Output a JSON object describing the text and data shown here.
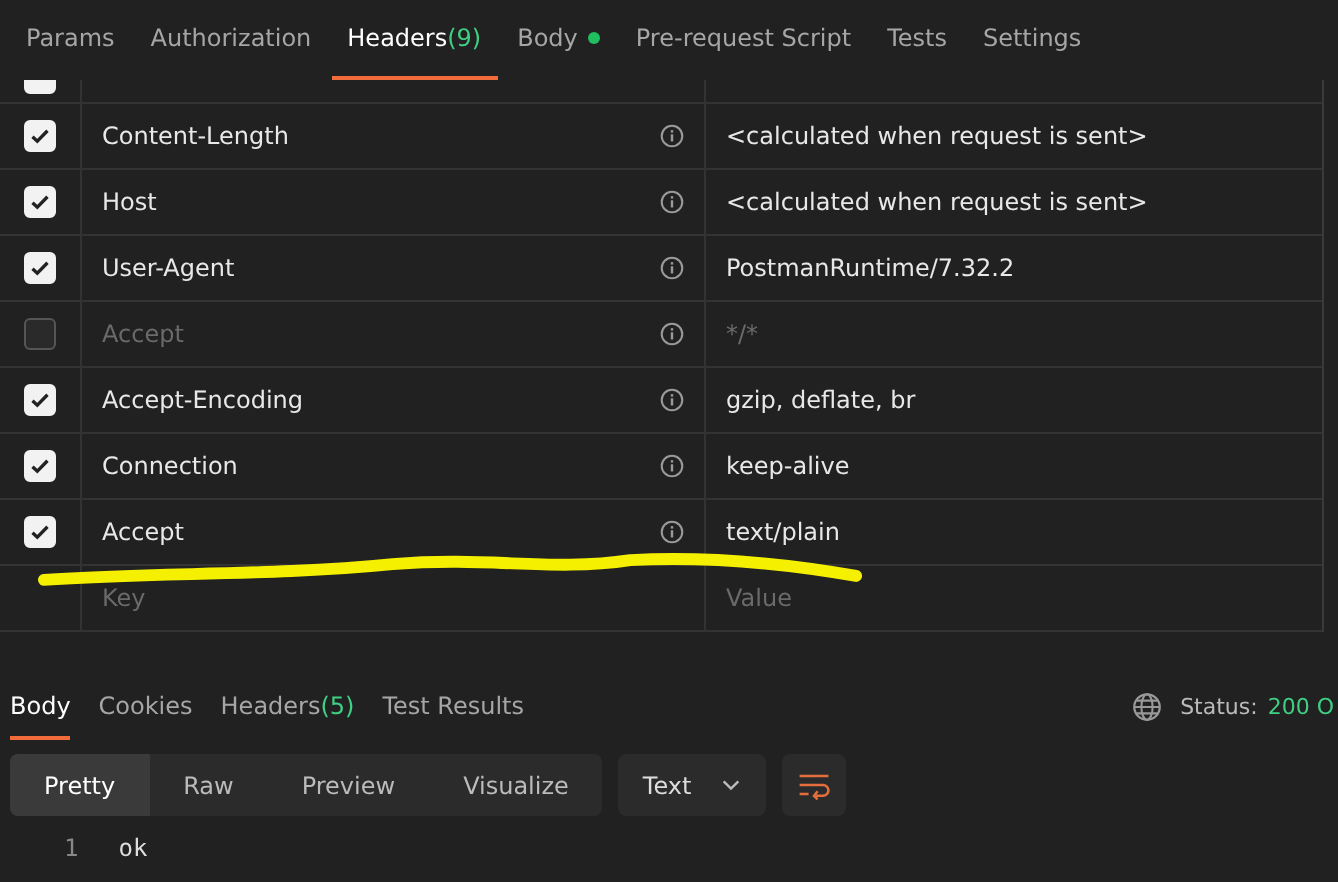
{
  "request_tabs": [
    {
      "label": "Params",
      "selected": false
    },
    {
      "label": "Authorization",
      "selected": false
    },
    {
      "label": "Headers",
      "count": "(9)",
      "selected": true
    },
    {
      "label": "Body",
      "dot": true,
      "selected": false
    },
    {
      "label": "Pre-request Script",
      "selected": false
    },
    {
      "label": "Tests",
      "selected": false
    },
    {
      "label": "Settings",
      "selected": false
    }
  ],
  "partial_row": {
    "checked": true
  },
  "headers": [
    {
      "key": "Content-Length",
      "value": "<calculated when request is sent>",
      "checked": true
    },
    {
      "key": "Host",
      "value": "<calculated when request is sent>",
      "checked": true
    },
    {
      "key": "User-Agent",
      "value": "PostmanRuntime/7.32.2",
      "checked": true
    },
    {
      "key": "Accept",
      "value": "*/*",
      "checked": false
    },
    {
      "key": "Accept-Encoding",
      "value": "gzip, deflate, br",
      "checked": true
    },
    {
      "key": "Connection",
      "value": "keep-alive",
      "checked": true
    },
    {
      "key": "Accept",
      "value": "text/plain",
      "checked": true
    }
  ],
  "new_row": {
    "key_placeholder": "Key",
    "value_placeholder": "Value"
  },
  "response_tabs": [
    {
      "label": "Body",
      "selected": true
    },
    {
      "label": "Cookies",
      "selected": false
    },
    {
      "label": "Headers",
      "count": "(5)",
      "selected": false
    },
    {
      "label": "Test Results",
      "selected": false
    }
  ],
  "status": {
    "label": "Status:",
    "value": "200 O"
  },
  "view_modes": [
    {
      "label": "Pretty",
      "selected": true
    },
    {
      "label": "Raw",
      "selected": false
    },
    {
      "label": "Preview",
      "selected": false
    },
    {
      "label": "Visualize",
      "selected": false
    }
  ],
  "format": "Text",
  "code_lines": [
    {
      "number": "1",
      "text": "ok"
    }
  ]
}
